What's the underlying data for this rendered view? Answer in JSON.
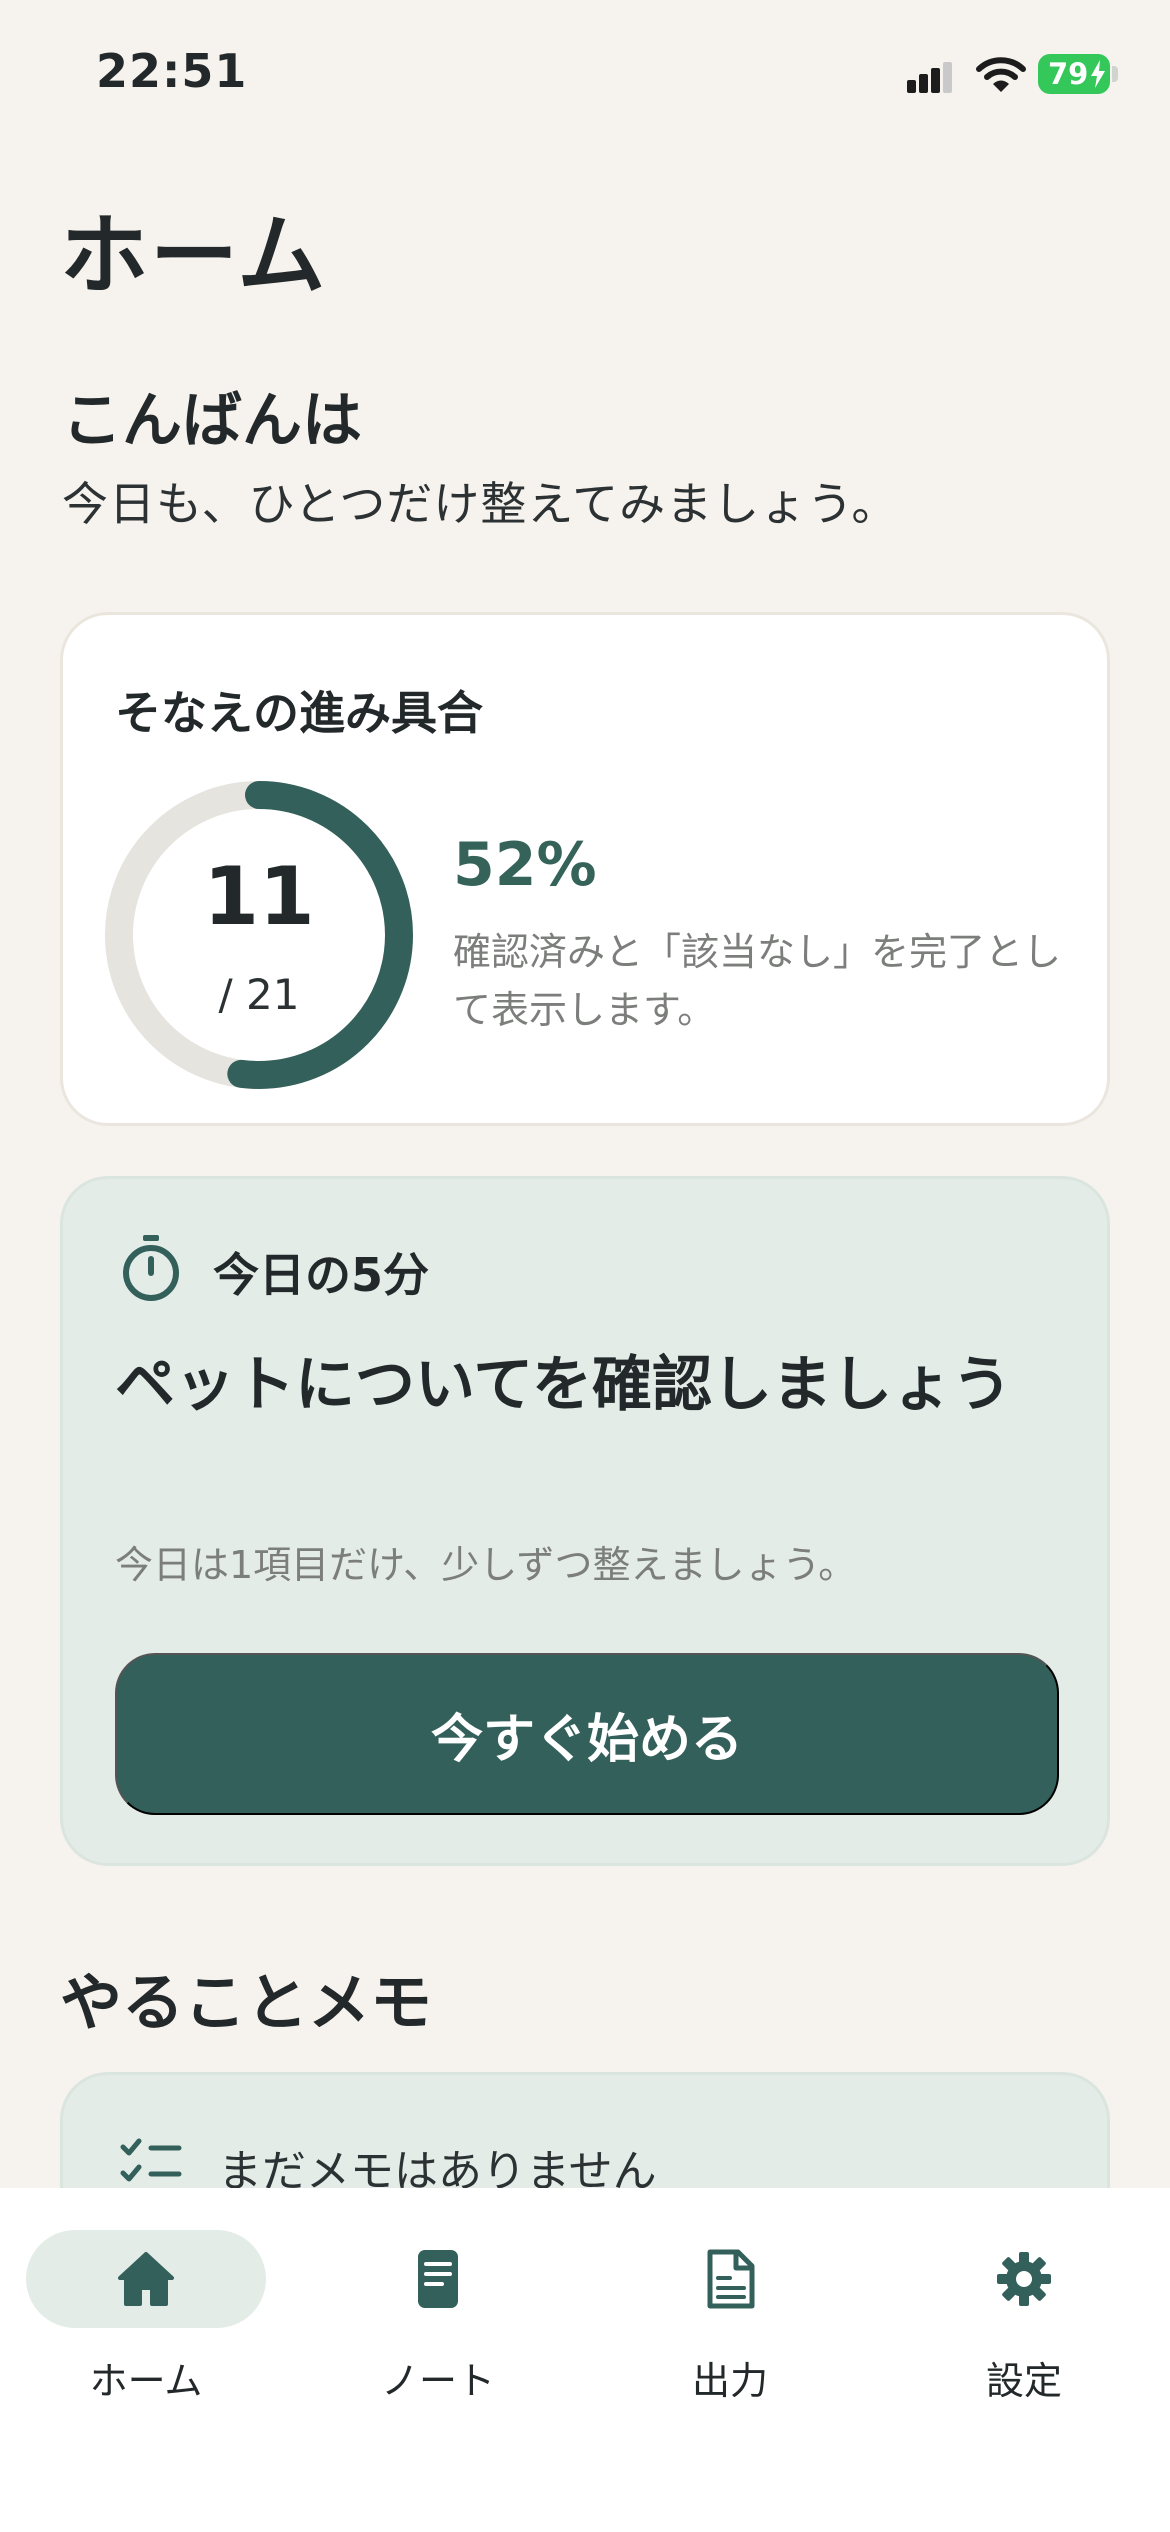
{
  "status_bar": {
    "time": "22:51",
    "battery": "79"
  },
  "header": {
    "title": "ホーム",
    "greeting": "こんばんは",
    "greeting_sub": "今日も、ひとつだけ整えてみましょう。"
  },
  "progress_card": {
    "title": "そなえの進み具合",
    "completed": "11",
    "total": "/ 21",
    "progress_fraction": 0.52,
    "percent": "52%",
    "note": "確認済みと「該当なし」を完了として表示します。"
  },
  "today_card": {
    "label": "今日の5分",
    "heading": "ペットについてを確認しましょう",
    "sub": "今日は1項目だけ、少しずつ整えましょう。",
    "button": "今すぐ始める"
  },
  "memo": {
    "title": "やることメモ",
    "empty": "まだメモはありません"
  },
  "tabs": [
    {
      "label": "ホーム",
      "icon": "home-icon",
      "active": true
    },
    {
      "label": "ノート",
      "icon": "note-icon",
      "active": false
    },
    {
      "label": "出力",
      "icon": "document-icon",
      "active": false
    },
    {
      "label": "設定",
      "icon": "gear-icon",
      "active": false
    }
  ],
  "colors": {
    "background": "#f6f3ee",
    "accent": "#33605a",
    "card_tint": "#e4ece8",
    "ring_track": "#e6e4df",
    "battery": "#34c759"
  }
}
